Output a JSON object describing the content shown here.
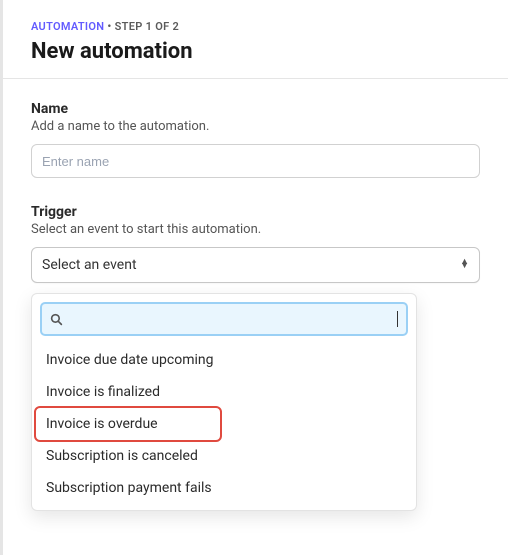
{
  "breadcrumb": {
    "automation": "AUTOMATION",
    "separator": " • ",
    "step": "STEP 1 OF 2"
  },
  "title": "New automation",
  "name_section": {
    "label": "Name",
    "sublabel": "Add a name to the automation.",
    "placeholder": "Enter name",
    "value": ""
  },
  "trigger_section": {
    "label": "Trigger",
    "sublabel": "Select an event to start this automation.",
    "select_placeholder": "Select an event",
    "search_value": "",
    "options": [
      "Invoice due date upcoming",
      "Invoice is finalized",
      "Invoice is overdue",
      "Subscription is canceled",
      "Subscription payment fails"
    ],
    "highlighted_index": 2
  }
}
